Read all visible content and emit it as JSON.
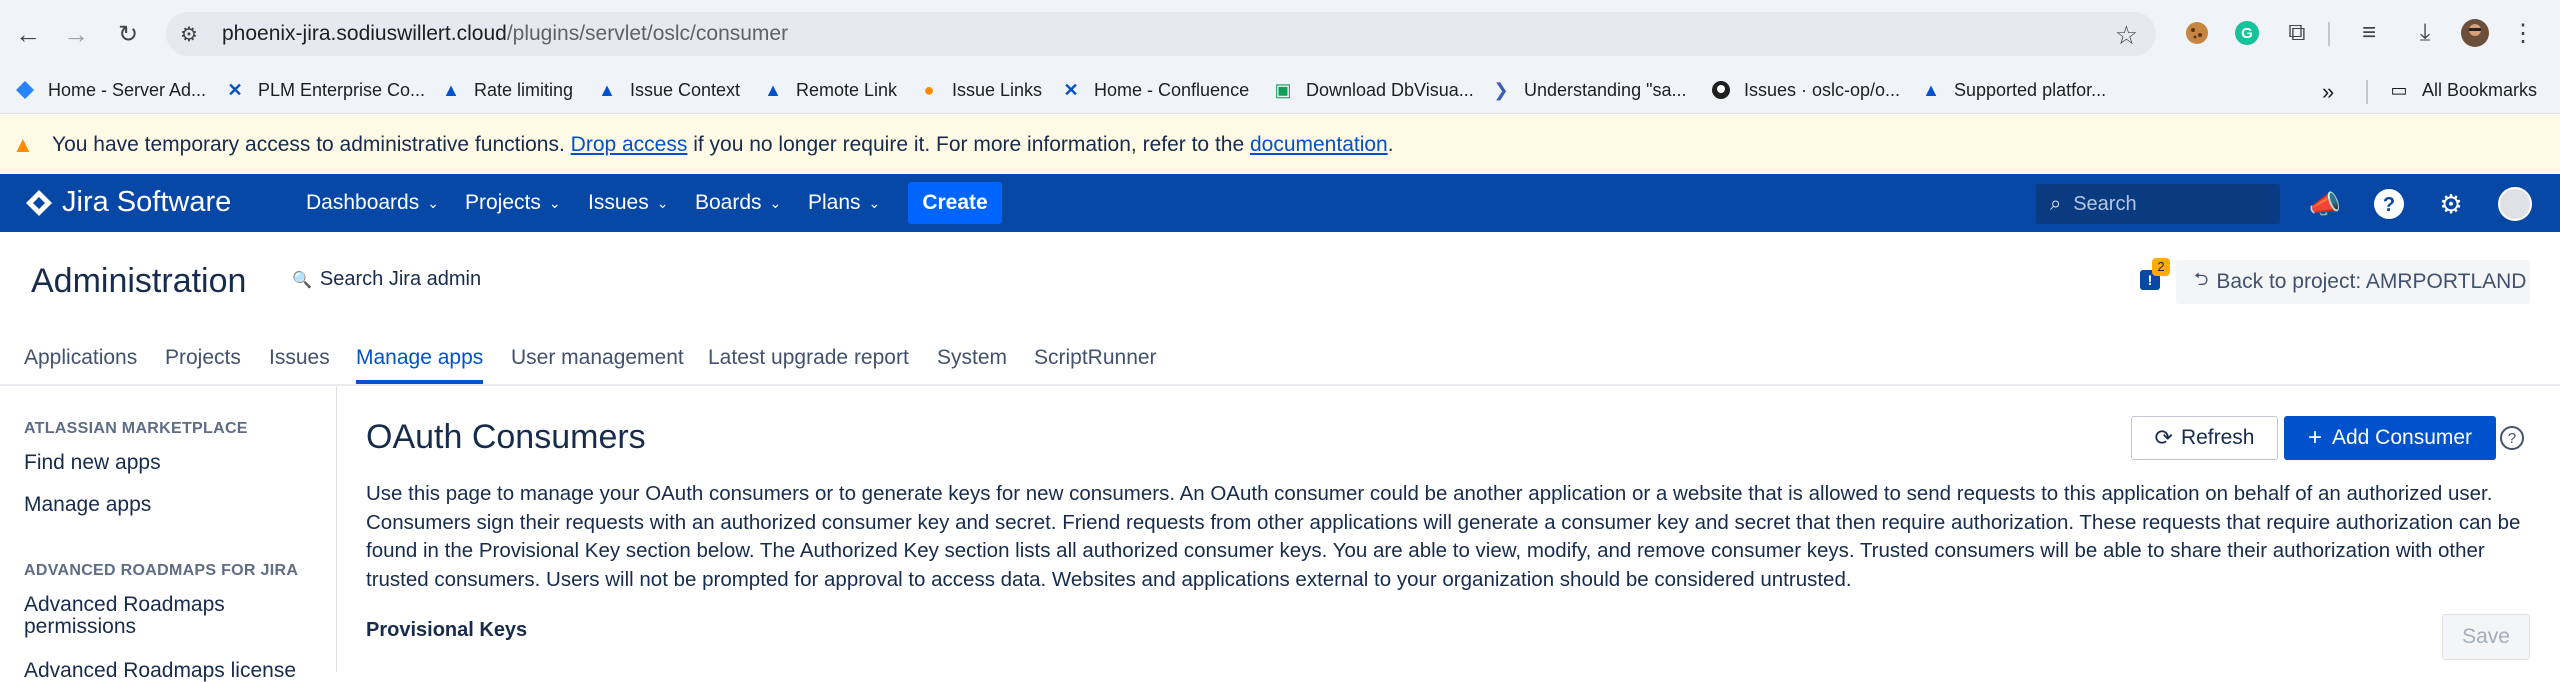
{
  "browser": {
    "url_host": "phoenix-jira.sodiuswillert.cloud",
    "url_path": "/plugins/servlet/oslc/consumer",
    "bookmarks": [
      {
        "label": "Home - Server Ad...",
        "icon": "jira-icon"
      },
      {
        "label": "PLM Enterprise Co...",
        "icon": "confluence-icon"
      },
      {
        "label": "Rate limiting",
        "icon": "atlassian-icon"
      },
      {
        "label": "Issue Context",
        "icon": "atlassian-icon"
      },
      {
        "label": "Remote Link",
        "icon": "atlassian-icon"
      },
      {
        "label": "Issue Links",
        "icon": "bitbucket-icon"
      },
      {
        "label": "Home - Confluence",
        "icon": "confluence-icon"
      },
      {
        "label": "Download DbVisua...",
        "icon": "dbvis-icon"
      },
      {
        "label": "Understanding \"sa...",
        "icon": "powershell-icon"
      },
      {
        "label": "Issues · oslc-op/o...",
        "icon": "github-icon"
      },
      {
        "label": "Supported platfor...",
        "icon": "atlassian-icon"
      }
    ],
    "all_bookmarks": "All Bookmarks"
  },
  "banner": {
    "text_before": "You have temporary access to administrative functions. ",
    "drop_link": "Drop access",
    "text_middle": " if you no longer require it. For more information, refer to the ",
    "doc_link": "documentation",
    "text_after": "."
  },
  "header": {
    "logo": "Jira Software",
    "nav": [
      "Dashboards",
      "Projects",
      "Issues",
      "Boards",
      "Plans"
    ],
    "create": "Create",
    "search_placeholder": "Search"
  },
  "admin": {
    "title": "Administration",
    "search": "Search Jira admin",
    "notif_count": "2",
    "back": "Back to project: AMRPORTLAND"
  },
  "tabs": [
    "Applications",
    "Projects",
    "Issues",
    "Manage apps",
    "User management",
    "Latest upgrade report",
    "System",
    "ScriptRunner"
  ],
  "sidebar": {
    "section1": "ATLASSIAN MARKETPLACE",
    "items1": [
      "Find new apps",
      "Manage apps"
    ],
    "section2": "ADVANCED ROADMAPS FOR JIRA",
    "item_perm_line1": "Advanced Roadmaps",
    "item_perm_line2": "permissions",
    "item_license": "Advanced Roadmaps license"
  },
  "main": {
    "title": "OAuth Consumers",
    "refresh": "Refresh",
    "add": "Add Consumer",
    "description": "Use this page to manage your OAuth consumers or to generate keys for new consumers. An OAuth consumer could be another application or a website that is allowed to send requests to this application on behalf of an authorized user. Consumers sign their requests with an authorized consumer key and secret. Friend requests from other applications will generate a consumer key and secret that then require authorization. These requests that require authorization can be found in the Provisional Key section below. The Authorized Key section lists all authorized consumer keys. You are able to view, modify, and remove consumer keys. Trusted consumers will be able to share their authorization with other trusted consumers. Users will not be prompted for approval to access data. Websites and applications external to your organization should be considered untrusted.",
    "provisional": "Provisional Keys",
    "save": "Save"
  },
  "colors": {
    "jira_header": "#0747a6",
    "primary": "#0052cc",
    "banner_bg": "#fffae6",
    "warning": "#ff8b00"
  }
}
